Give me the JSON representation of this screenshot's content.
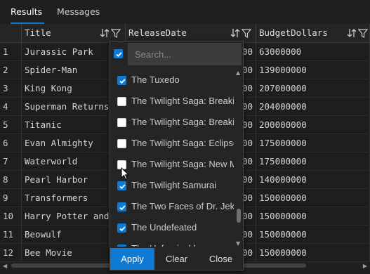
{
  "tabs": [
    {
      "label": "Results",
      "active": true
    },
    {
      "label": "Messages",
      "active": false
    }
  ],
  "columns": [
    {
      "label": "Title"
    },
    {
      "label": "ReleaseDate"
    },
    {
      "label": "BudgetDollars"
    }
  ],
  "rows": [
    {
      "n": "1",
      "title": "Jurassic Park",
      "date_tail": "00",
      "budget": "63000000"
    },
    {
      "n": "2",
      "title": "Spider-Man",
      "date_tail": "00",
      "budget": "139000000"
    },
    {
      "n": "3",
      "title": "King Kong",
      "date_tail": "00",
      "budget": "207000000"
    },
    {
      "n": "4",
      "title": "Superman Returns",
      "date_tail": "00",
      "budget": "204000000"
    },
    {
      "n": "5",
      "title": "Titanic",
      "date_tail": "00",
      "budget": "200000000"
    },
    {
      "n": "6",
      "title": "Evan Almighty",
      "date_tail": "00",
      "budget": "175000000"
    },
    {
      "n": "7",
      "title": "Waterworld",
      "date_tail": "00",
      "budget": "175000000"
    },
    {
      "n": "8",
      "title": "Pearl Harbor",
      "date_tail": "00",
      "budget": "140000000"
    },
    {
      "n": "9",
      "title": "Transformers",
      "date_tail": "00",
      "budget": "150000000"
    },
    {
      "n": "10",
      "title": "Harry Potter and",
      "date_tail": "00",
      "budget": "150000000"
    },
    {
      "n": "11",
      "title": "Beowulf",
      "date_tail": "00",
      "budget": "150000000"
    },
    {
      "n": "12",
      "title": "Bee Movie",
      "date_tail": "00",
      "budget": "150000000"
    }
  ],
  "filter_popup": {
    "select_all_checked": true,
    "search_placeholder": "Search...",
    "items": [
      {
        "label": "The Tuxedo",
        "checked": true
      },
      {
        "label": "The Twilight Saga: Breaki",
        "checked": false
      },
      {
        "label": "The Twilight Saga: Breaki",
        "checked": false
      },
      {
        "label": "The Twilight Saga: Eclipse",
        "checked": false
      },
      {
        "label": "The Twilight Saga: New M",
        "checked": false
      },
      {
        "label": "The Twilight Samurai",
        "checked": true
      },
      {
        "label": "The Two Faces of Dr. Jeky",
        "checked": true
      },
      {
        "label": "The Undefeated",
        "checked": true
      },
      {
        "label": "The Unforgivable",
        "checked": true
      }
    ],
    "apply_label": "Apply",
    "clear_label": "Clear",
    "close_label": "Close"
  },
  "colors": {
    "accent": "#0e7ad3",
    "background": "#1e1e1e",
    "header_bg": "#252526"
  },
  "icons": [
    "sort-icon",
    "filter-icon",
    "chevron-left-icon",
    "chevron-right-icon",
    "chevron-up-icon",
    "chevron-down-icon",
    "mouse-cursor-icon"
  ]
}
